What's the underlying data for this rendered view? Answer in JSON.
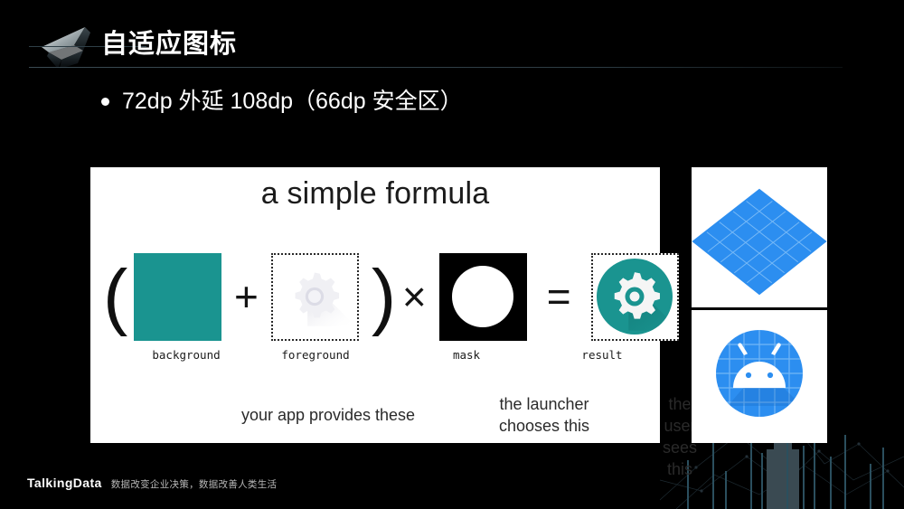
{
  "slide": {
    "title": "自适应图标",
    "bullet": "72dp 外延 108dp（66dp 安全区）"
  },
  "figure": {
    "title": "a simple formula",
    "operators": {
      "open_paren": "(",
      "plus": "+",
      "close_paren": ")",
      "times": "×",
      "equals": "="
    },
    "tiles": [
      {
        "label": "background",
        "kind": "solid-color-square",
        "color": "#1a9490"
      },
      {
        "label": "foreground",
        "kind": "gear-on-transparent",
        "color": "#e9e9ee"
      },
      {
        "label": "mask",
        "kind": "black-square-white-circle",
        "color": "#000000"
      },
      {
        "label": "result",
        "kind": "teal-circle-white-gear",
        "color": "#1a9490"
      }
    ],
    "captions": [
      "your app provides these",
      "the launcher\nchooses this",
      "the user\nsees this"
    ]
  },
  "right_images": [
    {
      "name": "blue-grid-plane",
      "color": "#2c8ef0"
    },
    {
      "name": "android-robot-circle",
      "color": "#2c8ef0"
    }
  ],
  "footer": {
    "brand": "TalkingData",
    "tagline": "数据改变企业决策，数据改善人类生活"
  },
  "colors": {
    "background": "#000000",
    "panel": "#ffffff",
    "teal": "#1a9490",
    "blue": "#2c8ef0",
    "rule": "#2f3f47"
  }
}
